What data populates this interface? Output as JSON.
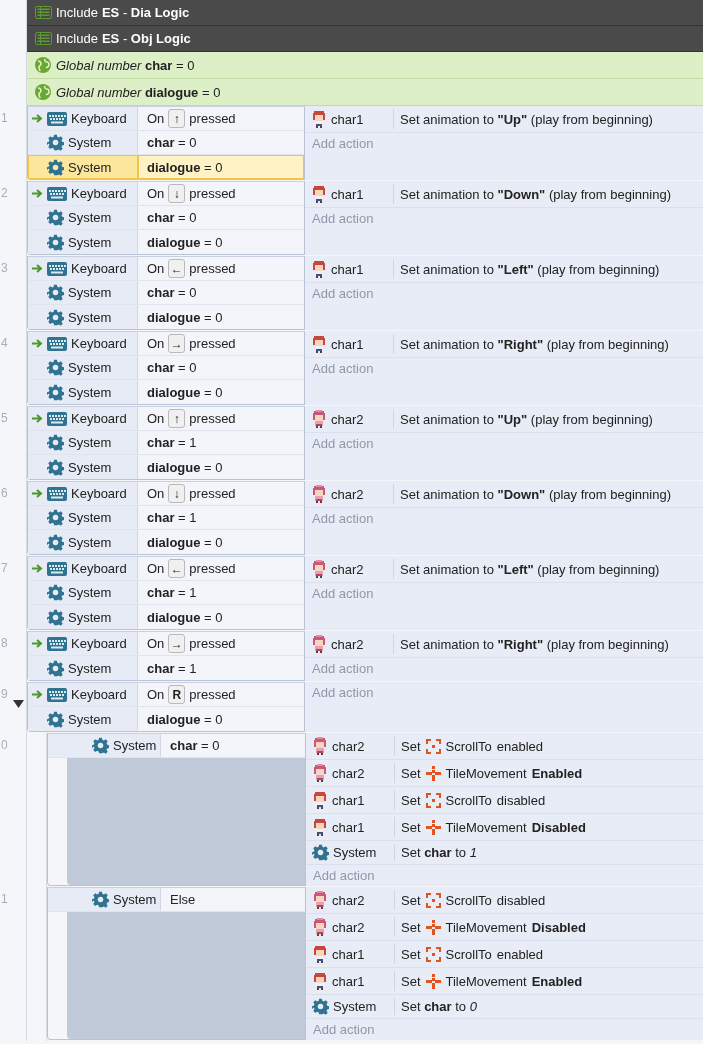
{
  "includes": [
    {
      "label": "Include",
      "sheet": "**ES** - **Dia Logic**"
    },
    {
      "label": "Include",
      "sheet": "**ES** - **Obj Logic**"
    }
  ],
  "globals": [
    {
      "text": "*Global number* **char** = 0"
    },
    {
      "text": "*Global number* **dialogue** = 0"
    }
  ],
  "events": [
    {
      "number": "1",
      "conditions": [
        {
          "kind": "keyboard",
          "object": "Keyboard",
          "trigger": true,
          "selected": false,
          "pre": "On",
          "key": "↑",
          "post": "pressed"
        },
        {
          "kind": "system",
          "object": "System",
          "trigger": false,
          "selected": false,
          "text": "**char** = 0"
        },
        {
          "kind": "system",
          "object": "System",
          "trigger": false,
          "selected": true,
          "text": "**dialogue** = 0"
        }
      ],
      "actions": [
        {
          "kind": "char1",
          "object": "char1",
          "text": "Set animation to **\"Up\"** (play from beginning)"
        }
      ],
      "add_action": "Add action"
    },
    {
      "number": "2",
      "conditions": [
        {
          "kind": "keyboard",
          "object": "Keyboard",
          "trigger": true,
          "selected": false,
          "pre": "On",
          "key": "↓",
          "post": "pressed"
        },
        {
          "kind": "system",
          "object": "System",
          "trigger": false,
          "selected": false,
          "text": "**char** = 0"
        },
        {
          "kind": "system",
          "object": "System",
          "trigger": false,
          "selected": false,
          "text": "**dialogue** = 0"
        }
      ],
      "actions": [
        {
          "kind": "char1",
          "object": "char1",
          "text": "Set animation to **\"Down\"** (play from beginning)"
        }
      ],
      "add_action": "Add action"
    },
    {
      "number": "3",
      "conditions": [
        {
          "kind": "keyboard",
          "object": "Keyboard",
          "trigger": true,
          "selected": false,
          "pre": "On",
          "key": "←",
          "post": "pressed"
        },
        {
          "kind": "system",
          "object": "System",
          "trigger": false,
          "selected": false,
          "text": "**char** = 0"
        },
        {
          "kind": "system",
          "object": "System",
          "trigger": false,
          "selected": false,
          "text": "**dialogue** = 0"
        }
      ],
      "actions": [
        {
          "kind": "char1",
          "object": "char1",
          "text": "Set animation to **\"Left\"** (play from beginning)"
        }
      ],
      "add_action": "Add action"
    },
    {
      "number": "4",
      "conditions": [
        {
          "kind": "keyboard",
          "object": "Keyboard",
          "trigger": true,
          "selected": false,
          "pre": "On",
          "key": "→",
          "post": "pressed"
        },
        {
          "kind": "system",
          "object": "System",
          "trigger": false,
          "selected": false,
          "text": "**char** = 0"
        },
        {
          "kind": "system",
          "object": "System",
          "trigger": false,
          "selected": false,
          "text": "**dialogue** = 0"
        }
      ],
      "actions": [
        {
          "kind": "char1",
          "object": "char1",
          "text": "Set animation to **\"Right\"** (play from beginning)"
        }
      ],
      "add_action": "Add action"
    },
    {
      "number": "5",
      "conditions": [
        {
          "kind": "keyboard",
          "object": "Keyboard",
          "trigger": true,
          "selected": false,
          "pre": "On",
          "key": "↑",
          "post": "pressed"
        },
        {
          "kind": "system",
          "object": "System",
          "trigger": false,
          "selected": false,
          "text": "**char** = 1"
        },
        {
          "kind": "system",
          "object": "System",
          "trigger": false,
          "selected": false,
          "text": "**dialogue** = 0"
        }
      ],
      "actions": [
        {
          "kind": "char2",
          "object": "char2",
          "text": "Set animation to **\"Up\"** (play from beginning)"
        }
      ],
      "add_action": "Add action"
    },
    {
      "number": "6",
      "conditions": [
        {
          "kind": "keyboard",
          "object": "Keyboard",
          "trigger": true,
          "selected": false,
          "pre": "On",
          "key": "↓",
          "post": "pressed"
        },
        {
          "kind": "system",
          "object": "System",
          "trigger": false,
          "selected": false,
          "text": "**char** = 1"
        },
        {
          "kind": "system",
          "object": "System",
          "trigger": false,
          "selected": false,
          "text": "**dialogue** = 0"
        }
      ],
      "actions": [
        {
          "kind": "char2",
          "object": "char2",
          "text": "Set animation to **\"Down\"** (play from beginning)"
        }
      ],
      "add_action": "Add action"
    },
    {
      "number": "7",
      "conditions": [
        {
          "kind": "keyboard",
          "object": "Keyboard",
          "trigger": true,
          "selected": false,
          "pre": "On",
          "key": "←",
          "post": "pressed"
        },
        {
          "kind": "system",
          "object": "System",
          "trigger": false,
          "selected": false,
          "text": "**char** = 1"
        },
        {
          "kind": "system",
          "object": "System",
          "trigger": false,
          "selected": false,
          "text": "**dialogue** = 0"
        }
      ],
      "actions": [
        {
          "kind": "char2",
          "object": "char2",
          "text": "Set animation to **\"Left\"** (play from beginning)"
        }
      ],
      "add_action": "Add action"
    },
    {
      "number": "8",
      "conditions": [
        {
          "kind": "keyboard",
          "object": "Keyboard",
          "trigger": true,
          "selected": false,
          "pre": "On",
          "key": "→",
          "post": "pressed"
        },
        {
          "kind": "system",
          "object": "System",
          "trigger": false,
          "selected": false,
          "text": "**char** = 1"
        }
      ],
      "actions": [
        {
          "kind": "char2",
          "object": "char2",
          "text": "Set animation to **\"Right\"** (play from beginning)"
        }
      ],
      "add_action": "Add action"
    },
    {
      "number": "9",
      "expanded": true,
      "conditions": [
        {
          "kind": "keyboard",
          "object": "Keyboard",
          "trigger": true,
          "selected": false,
          "pre": "On",
          "key": "R",
          "post": "pressed"
        },
        {
          "kind": "system",
          "object": "System",
          "trigger": false,
          "selected": false,
          "text": "**dialogue** = 0"
        }
      ],
      "add_action": "Add action",
      "children": [
        {
          "number": "0",
          "conditions": [
            {
              "kind": "system",
              "object": "System",
              "trigger": false,
              "selected": false,
              "text": "**char** = 0"
            }
          ],
          "actions": [
            {
              "kind": "char2",
              "object": "char2",
              "verb": "Set",
              "behavior": {
                "kind": "scroll",
                "name": "ScrollTo"
              },
              "text": "enabled"
            },
            {
              "kind": "char2",
              "object": "char2",
              "verb": "Set",
              "behavior": {
                "kind": "tile",
                "name": "TileMovement"
              },
              "text": "**Enabled**"
            },
            {
              "kind": "char1",
              "object": "char1",
              "verb": "Set",
              "behavior": {
                "kind": "scroll",
                "name": "ScrollTo"
              },
              "text": "disabled"
            },
            {
              "kind": "char1",
              "object": "char1",
              "verb": "Set",
              "behavior": {
                "kind": "tile",
                "name": "TileMovement"
              },
              "text": "**Disabled**"
            },
            {
              "kind": "system",
              "object": "System",
              "text": "Set **char** to *1*"
            }
          ],
          "add_action": "Add action"
        },
        {
          "number": "1",
          "conditions": [
            {
              "kind": "system",
              "object": "System",
              "trigger": false,
              "selected": false,
              "text": "Else"
            }
          ],
          "actions": [
            {
              "kind": "char2",
              "object": "char2",
              "verb": "Set",
              "behavior": {
                "kind": "scroll",
                "name": "ScrollTo"
              },
              "text": "disabled"
            },
            {
              "kind": "char2",
              "object": "char2",
              "verb": "Set",
              "behavior": {
                "kind": "tile",
                "name": "TileMovement"
              },
              "text": "**Disabled**"
            },
            {
              "kind": "char1",
              "object": "char1",
              "verb": "Set",
              "behavior": {
                "kind": "scroll",
                "name": "ScrollTo"
              },
              "text": "enabled"
            },
            {
              "kind": "char1",
              "object": "char1",
              "verb": "Set",
              "behavior": {
                "kind": "tile",
                "name": "TileMovement"
              },
              "text": "**Enabled**"
            },
            {
              "kind": "system",
              "object": "System",
              "text": "Set **char** to *0*"
            }
          ],
          "add_action": "Add action"
        }
      ]
    }
  ]
}
